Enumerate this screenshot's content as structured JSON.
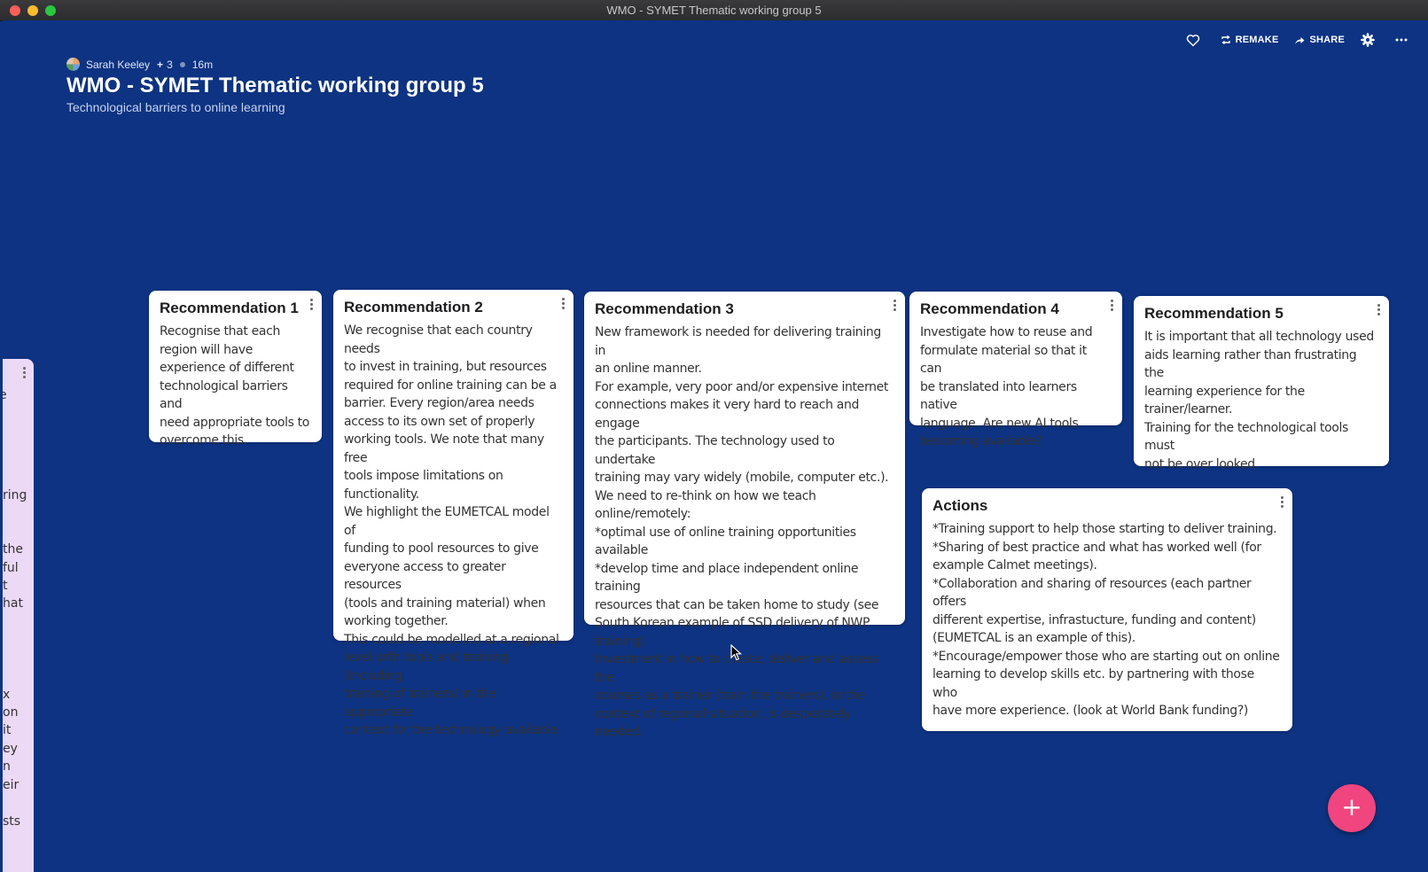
{
  "window": {
    "title": "WMO - SYMET Thematic working group 5"
  },
  "toolbar": {
    "like_icon": "heart-icon",
    "remake_label": "REMAKE",
    "share_label": "SHARE",
    "settings_icon": "gear-icon",
    "more_icon": "more-horizontal-icon"
  },
  "meta": {
    "author": "Sarah Keeley",
    "contributors": "3",
    "time": "16m"
  },
  "board": {
    "title": "WMO - SYMET Thematic working group 5",
    "subtitle": "Technological barriers to online learning"
  },
  "cards": [
    {
      "title": "Recommendation 1",
      "body": "Recognise that each\nregion will have\nexperience of different\ntechnological barriers and\nneed appropriate tools to\novercome this."
    },
    {
      "title": "Recommendation 2",
      "body": "We recognise that each country needs\nto invest in training, but resources\nrequired for online training can be a\nbarrier. Every region/area needs\naccess to its own set of properly\nworking tools. We note that many free\ntools impose limitations on\nfunctionality.\nWe highlight the EUMETCAL model of\nfunding to pool resources to give\neveryone access to greater resources\n(tools and training material) when\nworking together.\nThis could be modelled at a regional\nlevel with tools and training (including\ntraining of trainers) in the appropriate\ncontext for the technology available."
    },
    {
      "title": "Recommendation 3",
      "body": "New framework is needed for delivering training in\nan online manner.\nFor example, very poor and/or expensive internet\nconnections makes it very hard to reach and engage\nthe participants. The technology used to undertake\ntraining may vary widely (mobile, computer etc.).\nWe need to re-think on how we teach\nonline/remotely:\n*optimal use of online training opportunities available\n*develop time and place independent online training\nresources that can be taken home to study (see\nSouth Korean example of SSD delivery of NWP\ntraining)\nInvestment in how to create, deliver and assess the\ncourses as a trainer (train the trainers), in the\ncontext of regional situation, is desperately needed."
    },
    {
      "title": "Recommendation 4",
      "body": "Investigate how to reuse and\nformulate material so that it can\nbe translated into learners native\nlanguage. Are new AI tools\nbecoming available?"
    },
    {
      "title": "Recommendation 5",
      "body": "It is important that all technology used\naids learning rather than frustrating the\nlearning experience for the\ntrainer/learner.\nTraining for the technological tools must\nnot be over looked."
    },
    {
      "title": "Actions",
      "body": "*Training support to help those starting to deliver training.\n*Sharing of best practice and what has worked well (for\nexample Calmet meetings).\n*Collaboration and sharing of resources (each partner offers\ndifferent expertise, infrastucture, funding and content)\n(EUMETCAL is an example of this).\n*Encourage/empower those who are starting out on online\nlearning to develop skills etc. by partnering with those who\nhave more experience. (look at World Bank funding?)"
    }
  ],
  "left_panel_fragments": [
    "e",
    "ring",
    "the",
    "ful",
    "t",
    "hat",
    "x",
    "on",
    "it",
    "ey",
    "n",
    "eir",
    "sts"
  ],
  "fab": {
    "label": "+"
  },
  "colors": {
    "background": "#0d3382",
    "fab": "#f0457e",
    "side_panel": "#ecd9f6"
  }
}
